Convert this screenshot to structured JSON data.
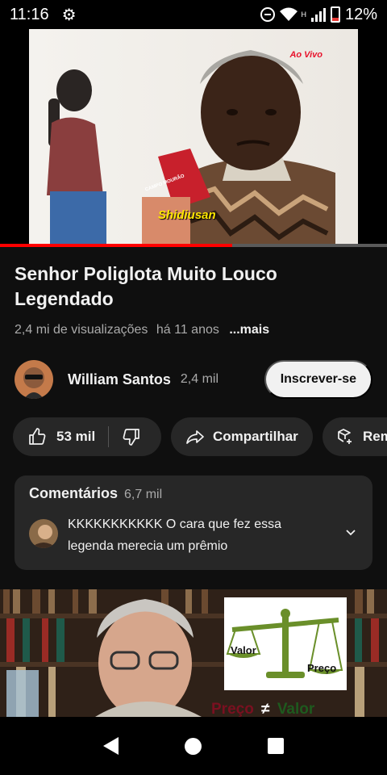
{
  "status_bar": {
    "time": "11:16",
    "network_label": "H",
    "battery_percent": "12%",
    "icons": [
      "gear-icon",
      "do-not-disturb-icon",
      "wifi-icon",
      "signal-icon",
      "battery-low-icon"
    ]
  },
  "player": {
    "overlay_live": "Ao Vivo",
    "overlay_name": "Shidiusan",
    "mic_label": "CAMPO MOURÃO",
    "progress": 0.6
  },
  "video": {
    "title": "Senhor Poliglota Muito Louco Legendado",
    "views": "2,4 mi de visualizações",
    "age": "há 11 anos",
    "more": "...mais"
  },
  "channel": {
    "name": "William Santos",
    "subscribers": "2,4 mil",
    "subscribe_label": "Inscrever-se"
  },
  "actions": {
    "likes": "53 mil",
    "share_label": "Compartilhar",
    "remix_label": "Remix"
  },
  "comments": {
    "title": "Comentários",
    "count": "6,7 mil",
    "top_comment": "KKKKKKKKKKK O cara que fez essa legenda merecia um prêmio"
  },
  "next_video": {
    "logo_left": "Valor",
    "logo_right": "Preço",
    "banner_left": "Preço",
    "banner_symbol": "≠",
    "banner_right": "Valor"
  },
  "colors": {
    "background": "#0f0f0f",
    "surface": "#272727",
    "progress": "#ff0000",
    "secondary_text": "#aaaaaa"
  }
}
